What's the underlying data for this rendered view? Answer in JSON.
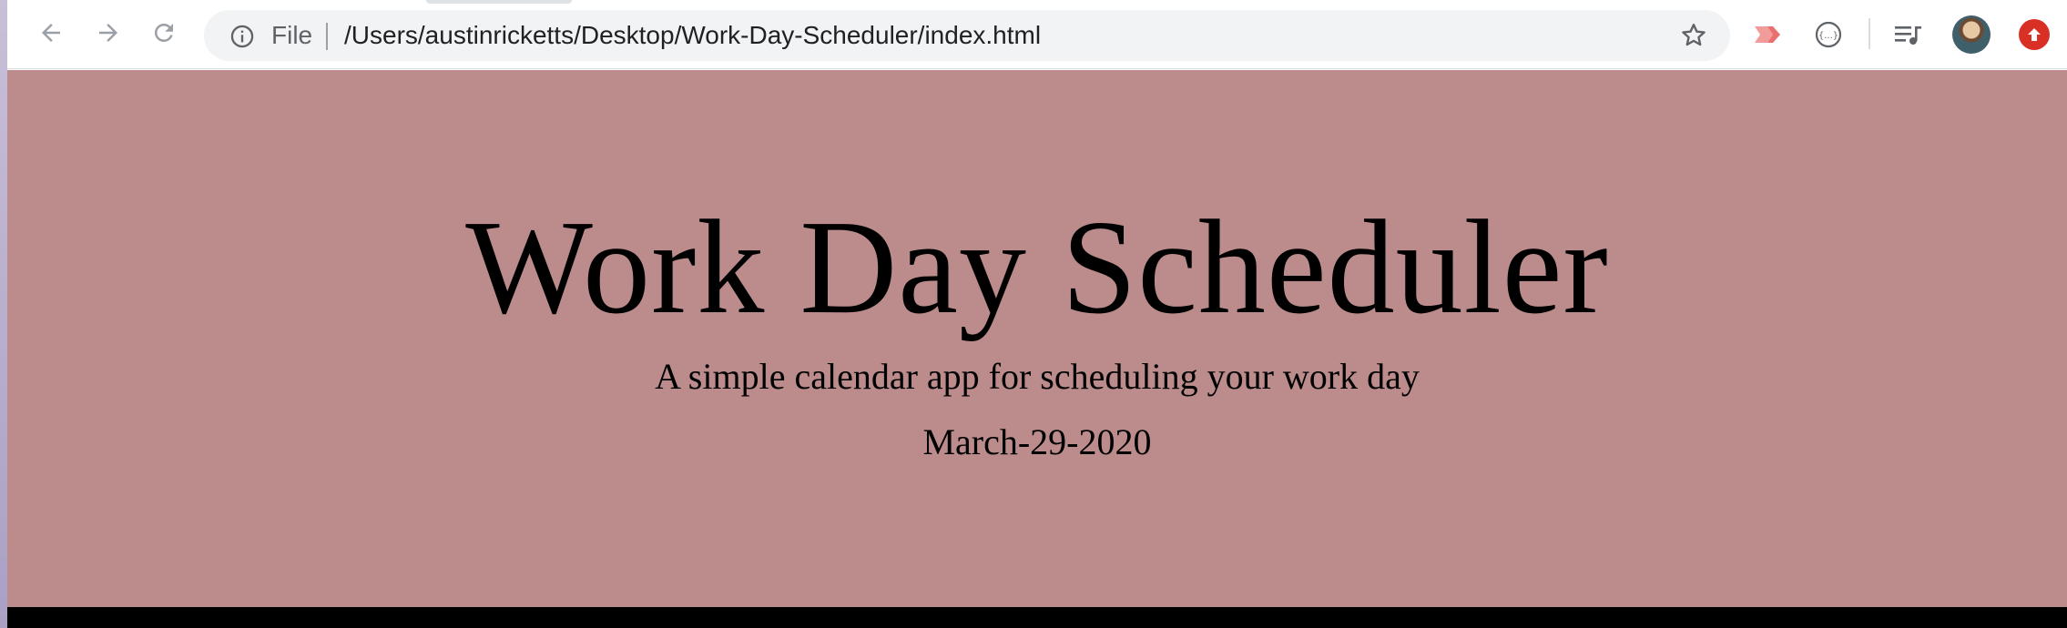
{
  "browser": {
    "omnibox": {
      "scheme_label": "File",
      "url": "/Users/austinricketts/Desktop/Work-Day-Scheduler/index.html"
    },
    "icons": [
      "back-icon",
      "forward-icon",
      "reload-icon",
      "info-icon",
      "star-icon",
      "cast-extension-icon",
      "json-extension-icon",
      "media-controls-icon",
      "profile-avatar",
      "update-icon"
    ]
  },
  "page": {
    "title": "Work Day Scheduler",
    "lead": "A simple calendar app for scheduling your work day",
    "current_day": "March-29-2020",
    "colors": {
      "jumbotron_bg": "#bc8c8c",
      "bottom_bar": "#000000",
      "update_badge": "#d93025"
    }
  }
}
